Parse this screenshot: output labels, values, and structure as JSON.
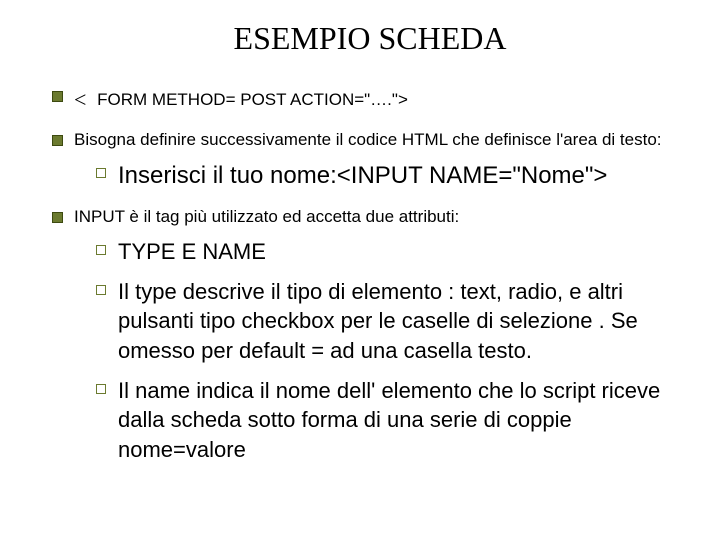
{
  "title": "ESEMPIO SCHEDA",
  "b1_prefix": "<",
  "b1_text": "FORM METHOD= POST ACTION=\"….\">",
  "b2": "Bisogna definire successivamente il codice HTML che definisce l'area di testo:",
  "b2_sub": "Inserisci il tuo nome:<INPUT NAME=\"Nome\">",
  "b3": "INPUT è il tag più utilizzato ed accetta due attributi:",
  "b3_sub1": "TYPE E NAME",
  "b3_sub2": "Il type descrive il tipo di elemento : text, radio, e altri pulsanti tipo checkbox per le caselle di selezione . Se omesso per default = ad una casella testo.",
  "b3_sub3": "Il name indica il nome dell' elemento che lo script riceve dalla scheda sotto forma di una serie di coppie nome=valore"
}
